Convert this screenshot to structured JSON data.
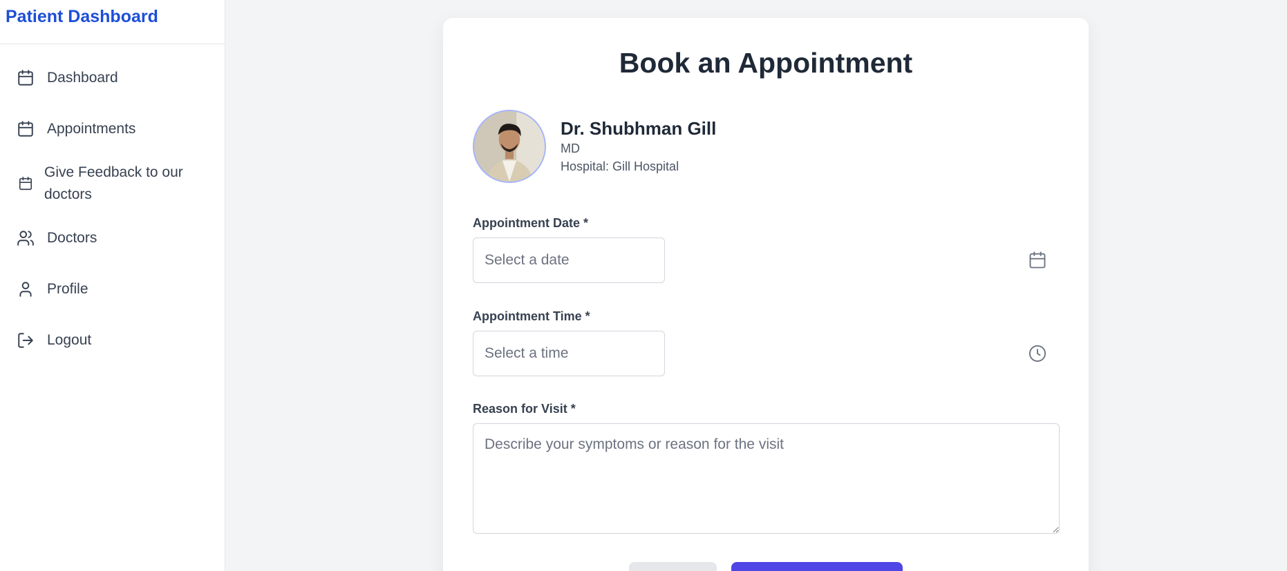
{
  "app": {
    "brand": "Patient Dashboard"
  },
  "sidebar": {
    "items": [
      {
        "label": "Dashboard",
        "icon": "calendar-icon"
      },
      {
        "label": "Appointments",
        "icon": "calendar-icon"
      },
      {
        "label": "Give Feedback to our doctors",
        "icon": "calendar-icon"
      },
      {
        "label": "Doctors",
        "icon": "users-icon"
      },
      {
        "label": "Profile",
        "icon": "user-icon"
      },
      {
        "label": "Logout",
        "icon": "logout-icon"
      }
    ]
  },
  "form": {
    "title": "Book an Appointment",
    "doctor": {
      "name": "Dr. Shubhman Gill",
      "degree": "MD",
      "hospital": "Hospital: Gill Hospital"
    },
    "date": {
      "label": "Appointment Date *",
      "placeholder": "Select a date",
      "value": ""
    },
    "time": {
      "label": "Appointment Time *",
      "placeholder": "Select a time",
      "value": ""
    },
    "reason": {
      "label": "Reason for Visit *",
      "placeholder": "Describe your symptoms or reason for the visit",
      "value": ""
    }
  },
  "colors": {
    "brand": "#1d4ed8",
    "primary_button": "#4f46e5",
    "secondary_button": "#e5e7eb",
    "background": "#f3f4f6"
  }
}
